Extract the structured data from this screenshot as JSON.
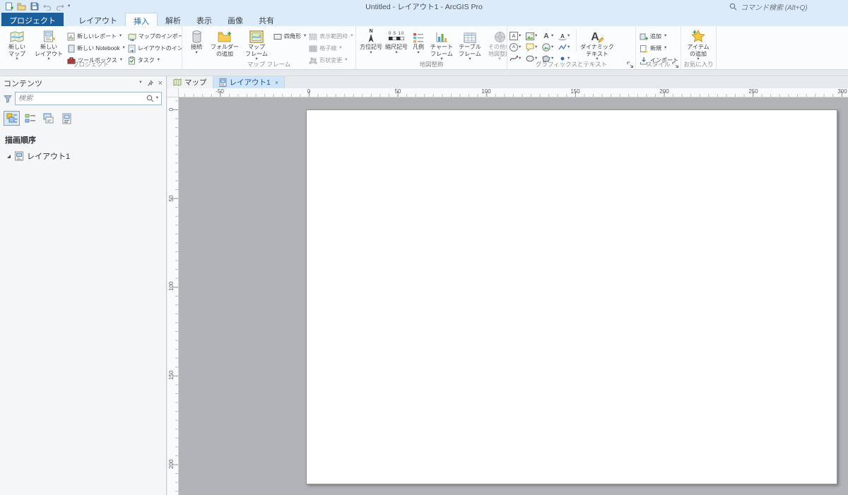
{
  "icons": {
    "caret": "▾",
    "close": "×",
    "letter_a": "A",
    "letter_n": "N",
    "scalebar_text": "0 5 10"
  },
  "titlebar": {
    "title": "Untitled - レイアウト1 - ArcGIS Pro",
    "command_search": "コマンド検索 (Alt+Q)"
  },
  "ribbon_tabs": [
    {
      "label": "プロジェクト"
    },
    {
      "label": "レイアウト"
    },
    {
      "label": "挿入"
    },
    {
      "label": "解析"
    },
    {
      "label": "表示"
    },
    {
      "label": "画像"
    },
    {
      "label": "共有"
    }
  ],
  "ribbon": {
    "groups": [
      {
        "label": "プロジェクト",
        "buttons": {
          "new_map": "新しい\nマップ",
          "new_layout": "新しい\nレイアウト",
          "new_report": "新しいレポート",
          "new_notebook": "新しい Notebook",
          "toolbox": "ツールボックス",
          "import_map": "マップのインポート",
          "import_layout": "レイアウトのインポート",
          "task": "タスク"
        }
      },
      {
        "label": "マップ フレーム",
        "buttons": {
          "connections": "接続",
          "add_folder": "フォルダー\nの追加",
          "map_frame": "マップ\nフレーム",
          "rectangle": "四角形",
          "extent_frame": "表示範囲枠",
          "grid": "格子線",
          "reshape": "形状変更"
        }
      },
      {
        "label": "地図整飾",
        "buttons": {
          "north_arrow": "方位記号",
          "scale_bar": "縮尺記号",
          "legend": "凡例",
          "chart_frame": "チャート\nフレーム",
          "table_frame": "テーブル\nフレーム",
          "other": "その他の\n地図整飾"
        }
      },
      {
        "label": "グラフィックスとテキスト",
        "buttons": {
          "dynamic_text": "ダイナミック\nテキスト"
        }
      },
      {
        "label": "スタイル",
        "buttons": {
          "add": "追加",
          "new": "新規",
          "import": "インポート"
        }
      },
      {
        "label": "お気に入り",
        "buttons": {
          "add_item": "アイテム\nの追加"
        }
      }
    ]
  },
  "contents_pane": {
    "title": "コンテンツ",
    "search_placeholder": "検索",
    "section_heading": "描画順序",
    "tree_items": [
      {
        "label": "レイアウト1"
      }
    ]
  },
  "view_tabs": [
    {
      "label": "マップ"
    },
    {
      "label": "レイアウト1"
    }
  ],
  "rulers": {
    "horizontal": [
      "-50",
      "0",
      "50",
      "100",
      "150",
      "200",
      "250",
      "300"
    ],
    "vertical": [
      "0",
      "50",
      "100",
      "150",
      "200"
    ]
  }
}
